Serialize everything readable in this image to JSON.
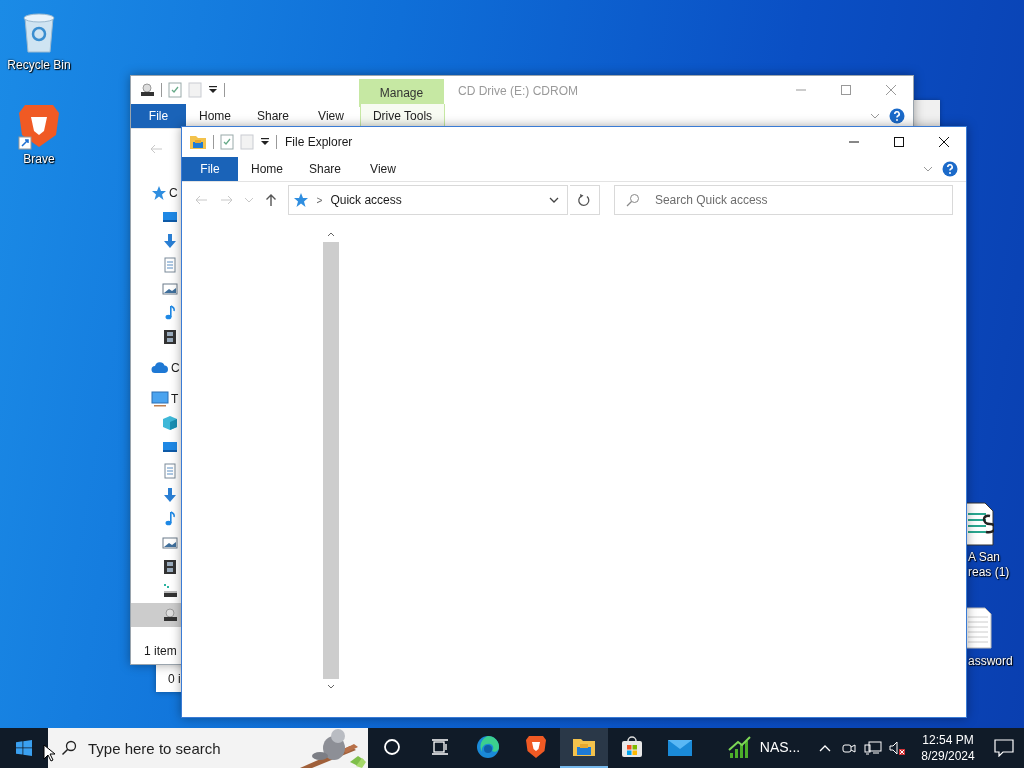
{
  "desktop_icons": [
    {
      "kind": "recycle",
      "lines": [
        "Recycle Bin"
      ]
    },
    {
      "kind": "brave",
      "lines": [
        "Brave"
      ]
    },
    {
      "kind": "script",
      "lines": [
        "A San",
        "reas (1)"
      ]
    },
    {
      "kind": "text",
      "lines": [
        "assword"
      ]
    }
  ],
  "drive_window": {
    "title": "CD Drive (E:) CDROM",
    "context_header": "Manage",
    "tabs": [
      {
        "label": "File",
        "kind": "file"
      },
      {
        "label": "Home",
        "kind": "plain"
      },
      {
        "label": "Share",
        "kind": "plain"
      },
      {
        "label": "View",
        "kind": "plain"
      },
      {
        "label": "Drive Tools",
        "kind": "context"
      }
    ],
    "nav": [
      {
        "kind": "star",
        "label": "C",
        "selected": false,
        "children": [
          {
            "kind": "desktop",
            "selected": false
          },
          {
            "kind": "download",
            "selected": false
          },
          {
            "kind": "document",
            "selected": false
          },
          {
            "kind": "pictures",
            "selected": false
          },
          {
            "kind": "music",
            "selected": false
          },
          {
            "kind": "video",
            "selected": false
          }
        ]
      },
      {
        "kind": "cloud",
        "label": "C",
        "selected": false
      },
      {
        "kind": "pc",
        "label": "T",
        "selected": false,
        "children": [
          {
            "kind": "cube",
            "selected": false
          },
          {
            "kind": "desktop",
            "selected": false
          },
          {
            "kind": "document",
            "selected": false
          },
          {
            "kind": "download",
            "selected": false
          },
          {
            "kind": "music",
            "selected": false
          },
          {
            "kind": "pictures",
            "selected": false
          },
          {
            "kind": "video",
            "selected": false
          },
          {
            "kind": "drive",
            "selected": false
          },
          {
            "kind": "cd",
            "selected": true
          }
        ]
      }
    ],
    "status": "1 item"
  },
  "behind_window": {
    "status": "0 i"
  },
  "explorer_window": {
    "title": "File Explorer",
    "tabs": [
      {
        "label": "File",
        "kind": "file"
      },
      {
        "label": "Home",
        "kind": "plain"
      },
      {
        "label": "Share",
        "kind": "plain"
      },
      {
        "label": "View",
        "kind": "plain"
      }
    ],
    "address": {
      "separator": ">",
      "location": "Quick access"
    },
    "search": {
      "placeholder": "Search Quick access"
    }
  },
  "taskbar": {
    "search": {
      "placeholder": "Type here to search"
    },
    "apps": [
      {
        "kind": "cortana",
        "active": false
      },
      {
        "kind": "taskview",
        "active": false
      },
      {
        "kind": "edge",
        "active": false
      },
      {
        "kind": "brave",
        "active": false
      },
      {
        "kind": "explorer",
        "active": true
      },
      {
        "kind": "store",
        "active": false
      },
      {
        "kind": "mail",
        "active": false
      },
      {
        "kind": "stocks",
        "label": "NAS...",
        "active": false
      }
    ],
    "tray": {
      "volume_muted": true
    },
    "clock": {
      "time": "12:54 PM",
      "date": "8/29/2024"
    }
  }
}
